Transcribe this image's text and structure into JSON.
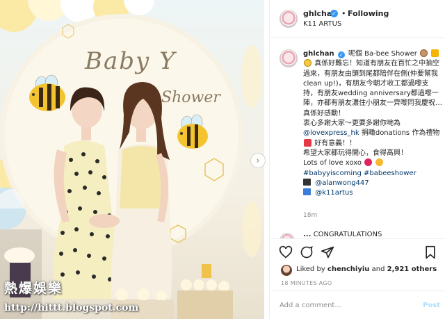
{
  "photo": {
    "alt": "",
    "watermark_title": "熱爆娛樂",
    "watermark_url": "http://hittt.blogspot.com",
    "backdrop_text": "Baby Y",
    "backdrop_sub": "Shower"
  },
  "header": {
    "username": "ghlchan",
    "verified_mark": "✓",
    "separator": "•",
    "follow_label": "Following",
    "location": "K11 ARTUS"
  },
  "caption": {
    "username": "ghlchan",
    "intro": "呢個 Ba-bee Shower",
    "line1": "真係好難忘！知道有朋友在百忙之中抽空過來，有朋友由頭到尾都陪伴在側(仲要幫我clean up!)，有朋友今朝才收工都過嚟支持，有朋友wedding anniversary都過嚟一陣，亦都有朋友濃住小朋友一齊嚟同我慶祝…真係好感動！",
    "line2a": "衷心多謝大家～更要多謝你哋為",
    "mention1": "@lovexpress_hk",
    "line2b": "捐瞰donations 作為禮物",
    "line2c": "好有意義！！",
    "line3": "希望大家都玩得開心，食得高興！",
    "line4": "Lots of love xoxo",
    "hashtag1": "#babyyiscoming",
    "hashtag2": "#babeeshower",
    "mention2": "@alanwong447",
    "mention3": "@k11artus",
    "age": "18m"
  },
  "comment_peek": {
    "username": "...",
    "text": "CONGRATULATIONS"
  },
  "actions": {
    "icons": [
      "heart-icon",
      "comment-icon",
      "share-icon",
      "bookmark-icon"
    ],
    "liked_by_prefix": "Liked by",
    "liked_by_user": "chenchiyiu",
    "liked_by_and": "and",
    "liked_by_count": "2,921 others",
    "timestamp": "18 MINUTES AGO"
  },
  "add_comment": {
    "placeholder": "Add a comment...",
    "post_label": "Post"
  },
  "colors": {
    "link": "#00376b",
    "verified": "#3897f0",
    "muted": "#8e8e8e",
    "post_disabled": "#b2dffc"
  }
}
